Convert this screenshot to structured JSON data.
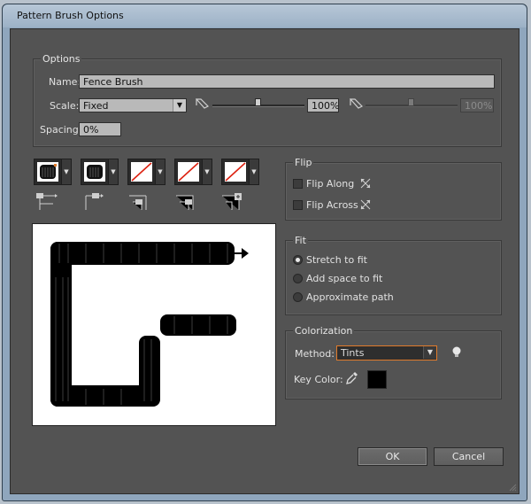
{
  "window": {
    "title": "Pattern Brush Options"
  },
  "options": {
    "group_title": "Options",
    "name_label": "Name:",
    "name_value": "Fence Brush",
    "scale_label": "Scale:",
    "scale_value": "Fixed",
    "scale_min": "100%",
    "scale_max": "100%",
    "spacing_label": "Spacing:",
    "spacing_value": "0%"
  },
  "tiles": [
    {
      "name": "side-tile",
      "kind": "pattern"
    },
    {
      "name": "outer-corner-tile",
      "kind": "pattern"
    },
    {
      "name": "inner-corner-tile",
      "kind": "none"
    },
    {
      "name": "start-tile",
      "kind": "none"
    },
    {
      "name": "end-tile",
      "kind": "none"
    }
  ],
  "flip": {
    "group_title": "Flip",
    "flip_along_label": "Flip Along",
    "flip_across_label": "Flip Across"
  },
  "fit": {
    "group_title": "Fit",
    "options": [
      "Stretch to fit",
      "Add space to fit",
      "Approximate path"
    ],
    "selected": "Stretch to fit"
  },
  "colorization": {
    "group_title": "Colorization",
    "method_label": "Method:",
    "method_value": "Tints",
    "key_color_label": "Key Color:",
    "key_color": "#000000",
    "accent_color": "#e07b2b"
  },
  "buttons": {
    "ok_label": "OK",
    "cancel_label": "Cancel"
  }
}
